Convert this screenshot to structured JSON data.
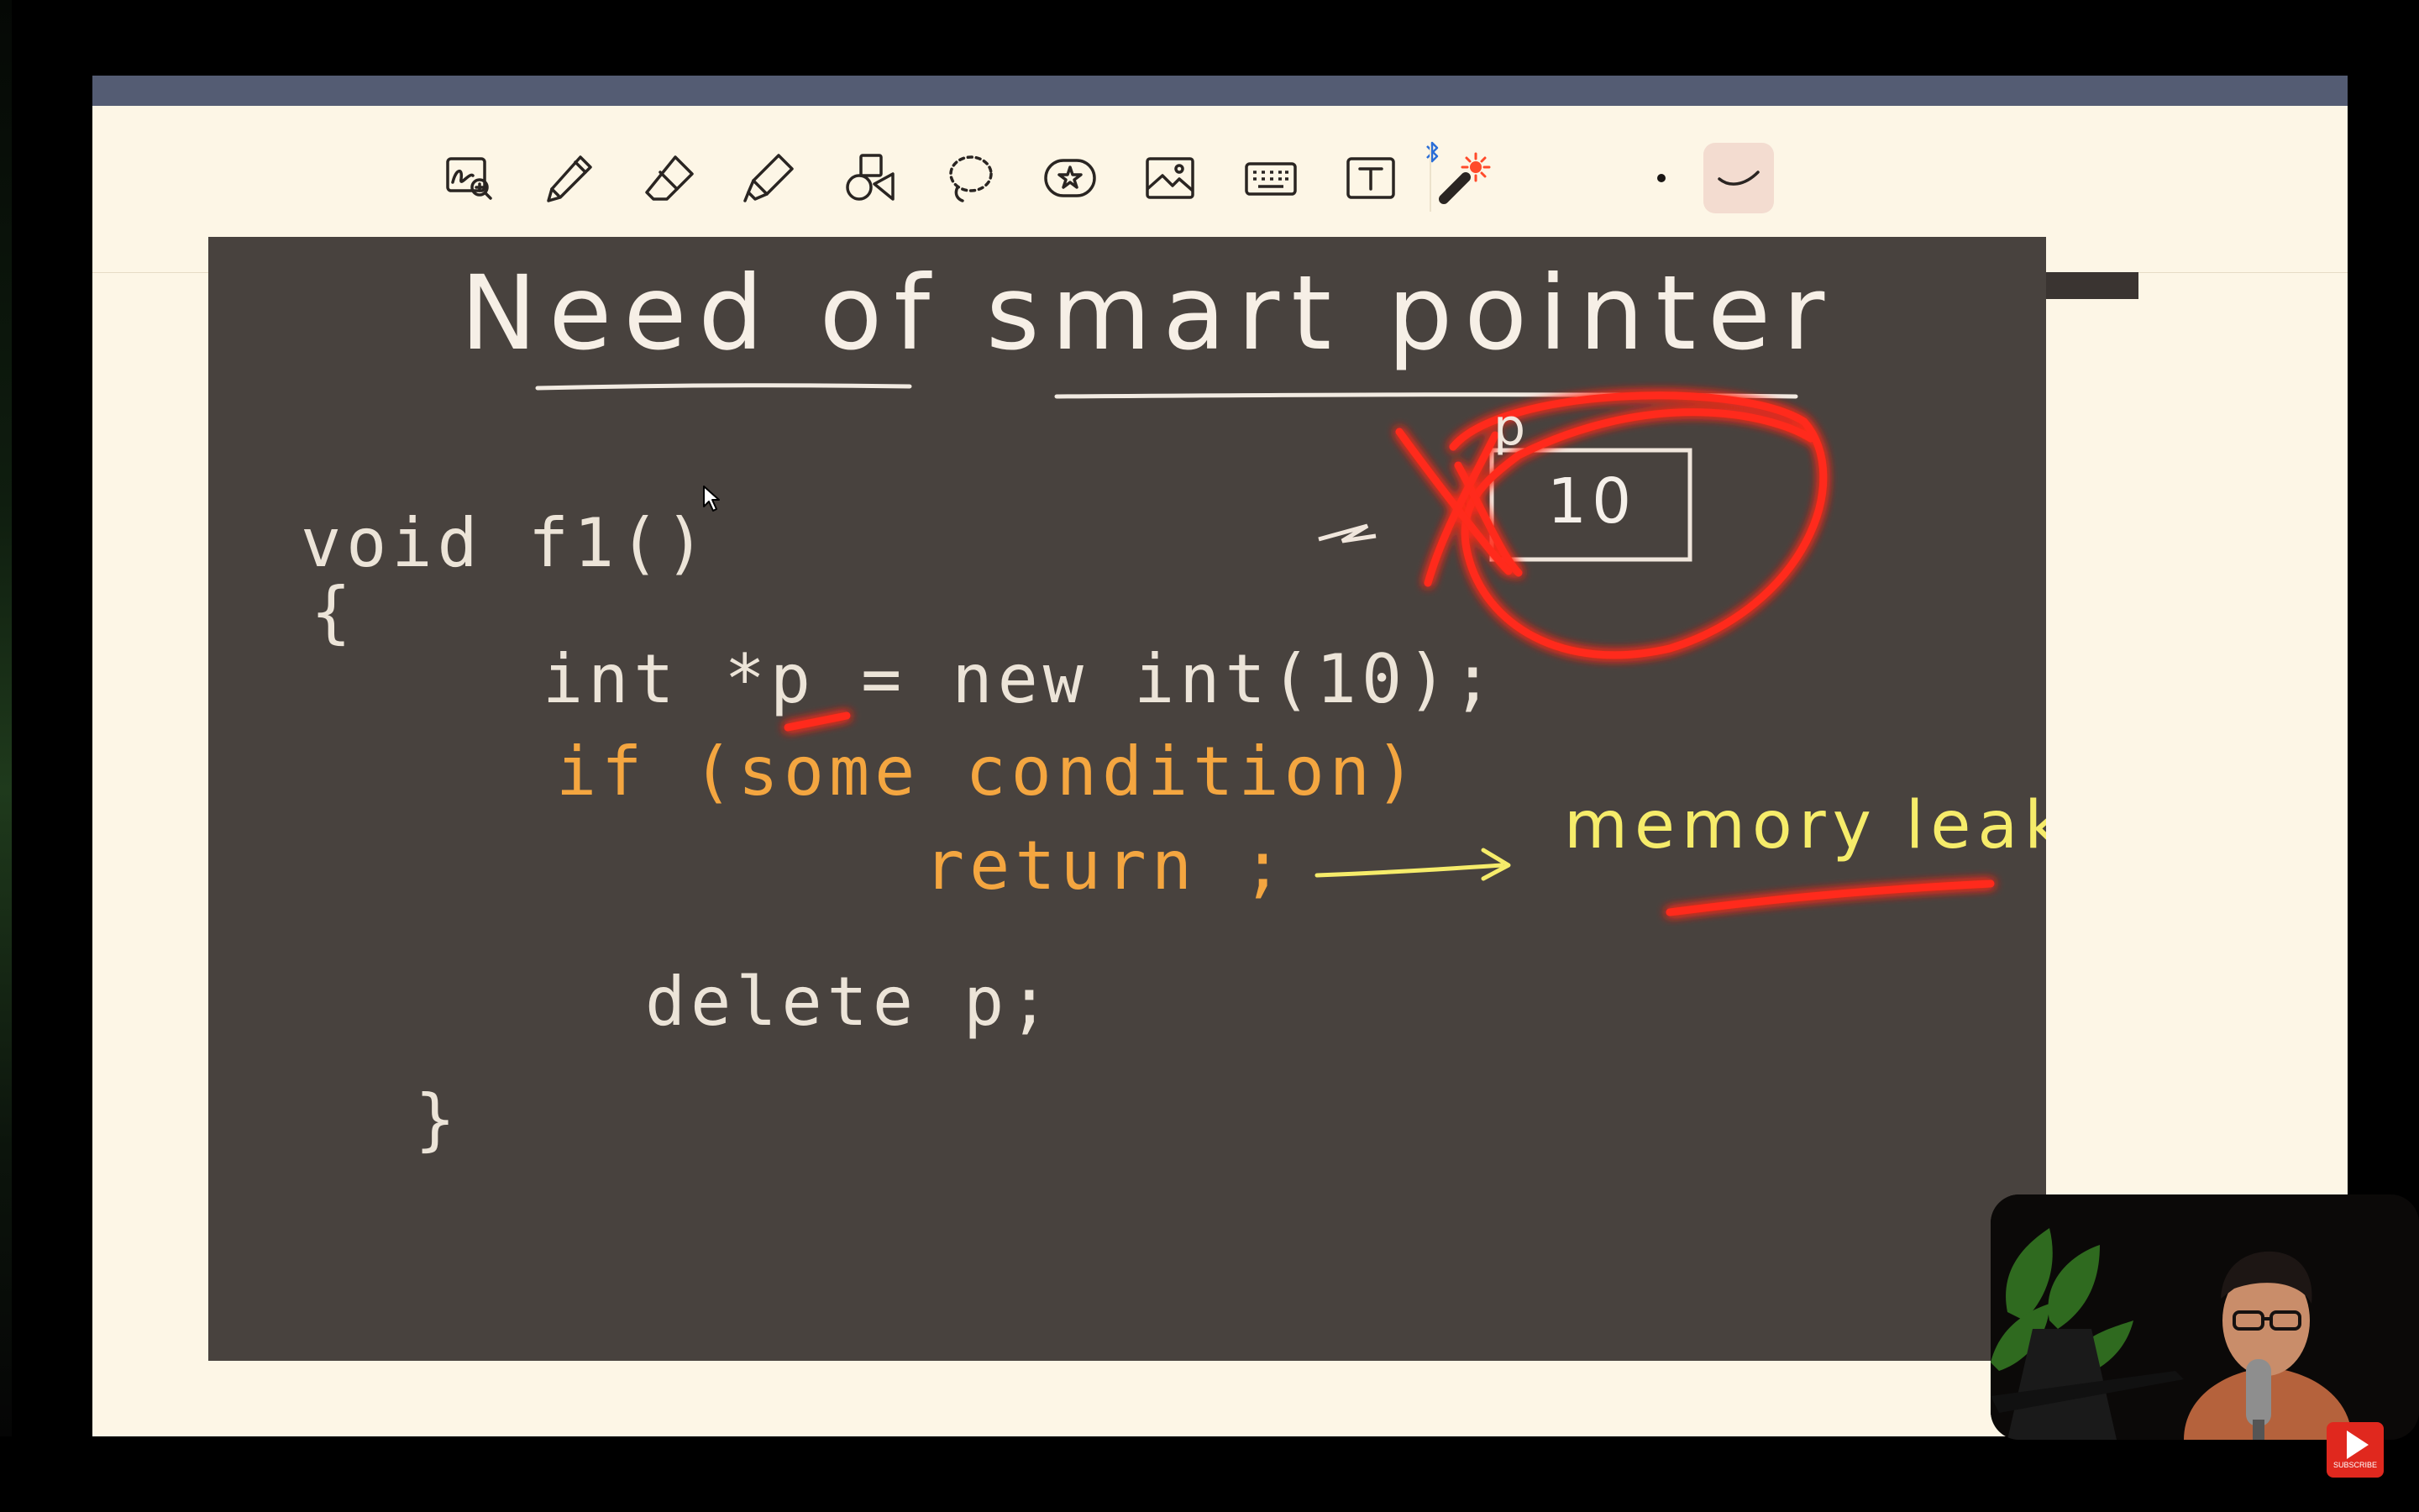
{
  "toolbar": {
    "tools": [
      {
        "name": "lasso-zoom-icon"
      },
      {
        "name": "pen-icon"
      },
      {
        "name": "eraser-icon"
      },
      {
        "name": "highlighter-icon"
      },
      {
        "name": "shapes-icon"
      },
      {
        "name": "lasso-select-icon"
      },
      {
        "name": "sticker-icon"
      },
      {
        "name": "image-icon"
      },
      {
        "name": "keyboard-icon"
      },
      {
        "name": "text-box-icon"
      },
      {
        "name": "laser-pointer-icon"
      }
    ],
    "bluetooth_icon": "bluetooth-icon",
    "active_tool": "laser-trail-icon"
  },
  "board": {
    "title": "Need of smart pointer",
    "code": {
      "line1": "void f1()",
      "line2": "{",
      "line3": "int *p = new int(10);",
      "line4": "if (some condition)",
      "line5": "return ;",
      "line6": "delete p;",
      "line7": "}"
    },
    "annotation": "memory leak",
    "box_value": "10",
    "pointer_label": "p"
  },
  "colors": {
    "board": "#48423e",
    "chalk": "#ece4d8",
    "orange": "#f4a640",
    "yellow": "#f6ec6a",
    "laser_red": "#ff2a1a",
    "app_bg": "#fdf6e6",
    "titlebar": "#545c73"
  },
  "overlay": {
    "subscribe_label": "SUBSCRIBE"
  }
}
